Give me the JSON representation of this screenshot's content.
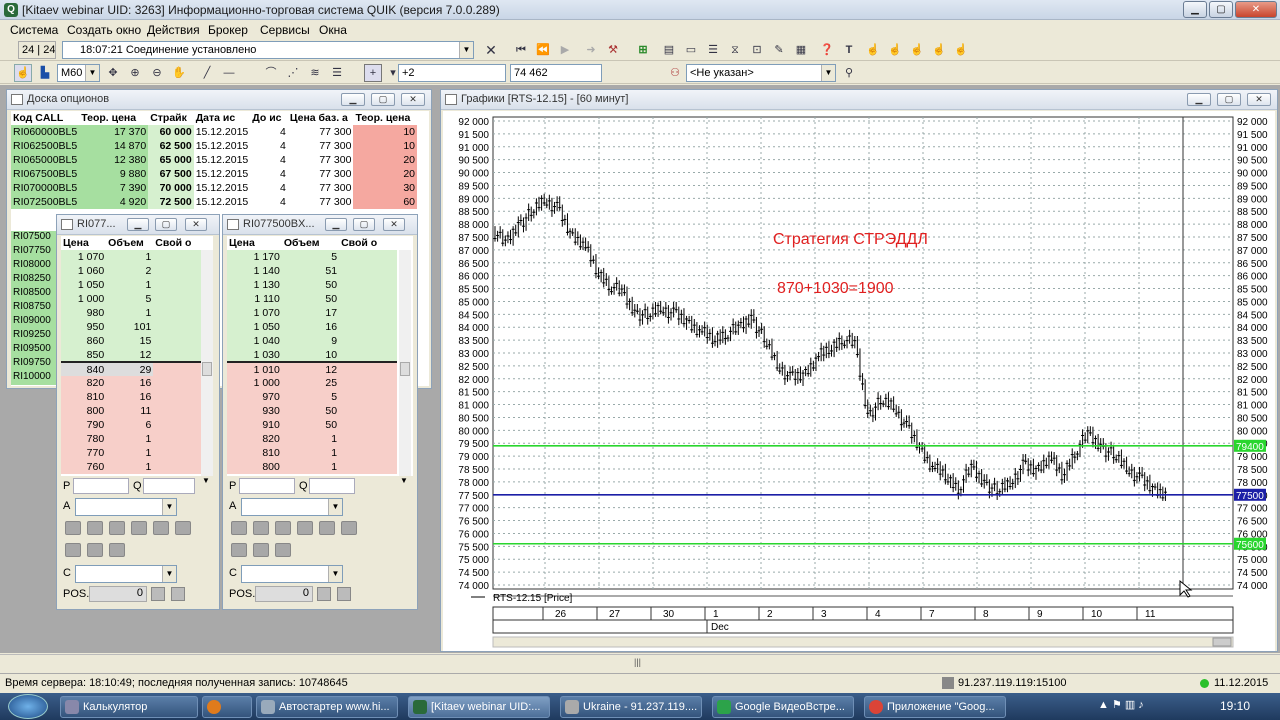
{
  "window": {
    "title": "[Kitaev webinar UID: 3263] Информационно-торговая система QUIK (версия 7.0.0.289)",
    "icon": "quik-logo-icon"
  },
  "menu": [
    "Система",
    "Создать окно",
    "Действия",
    "Брокер",
    "Сервисы",
    "Окна"
  ],
  "toolbar": {
    "clock": "24 | 24",
    "message": "18:07:21  Соединение установлено",
    "interval": "M60",
    "step": "+2",
    "value": "74 462",
    "account": "<Не указан>"
  },
  "options_board": {
    "title": "Доска опционов",
    "headers": [
      "Код CALL",
      "Теор. цена",
      "Страйк",
      "Дата ис",
      "До ис",
      "Цена баз. а",
      "Теор. цена"
    ],
    "rows": [
      [
        "RI060000BL5",
        "17 370",
        "60 000",
        "15.12.2015",
        "4",
        "77 300",
        "10"
      ],
      [
        "RI062500BL5",
        "14 870",
        "62 500",
        "15.12.2015",
        "4",
        "77 300",
        "10"
      ],
      [
        "RI065000BL5",
        "12 380",
        "65 000",
        "15.12.2015",
        "4",
        "77 300",
        "20"
      ],
      [
        "RI067500BL5",
        "9 880",
        "67 500",
        "15.12.2015",
        "4",
        "77 300",
        "20"
      ],
      [
        "RI070000BL5",
        "7 390",
        "70 000",
        "15.12.2015",
        "4",
        "77 300",
        "30"
      ],
      [
        "RI072500BL5",
        "4 920",
        "72 500",
        "15.12.2015",
        "4",
        "77 300",
        "60"
      ]
    ],
    "left_codes": [
      "RI07500",
      "RI07750",
      "RI08000",
      "RI08250",
      "RI08500",
      "RI08750",
      "RI09000",
      "RI09250",
      "RI09500",
      "RI09750",
      "RI10000"
    ]
  },
  "orderbook1": {
    "title": "RI077...",
    "headers": [
      "Цена",
      "Объем",
      "Свой о"
    ],
    "bids_sell": [
      [
        "1 070",
        "1"
      ],
      [
        "1 060",
        "2"
      ],
      [
        "1 050",
        "1"
      ],
      [
        "1 000",
        "5"
      ],
      [
        "980",
        "1"
      ],
      [
        "950",
        "101"
      ],
      [
        "860",
        "15"
      ],
      [
        "850",
        "12"
      ]
    ],
    "buys": [
      [
        "840",
        "29"
      ],
      [
        "820",
        "16"
      ],
      [
        "810",
        "16"
      ],
      [
        "800",
        "11"
      ],
      [
        "790",
        "6"
      ],
      [
        "780",
        "1"
      ],
      [
        "770",
        "1"
      ],
      [
        "760",
        "1"
      ]
    ],
    "labels": {
      "p": "P",
      "q": "Q",
      "a": "A",
      "c": "C",
      "pos": "POS.",
      "pos_val": "0"
    }
  },
  "orderbook2": {
    "title": "RI077500BX...",
    "headers": [
      "Цена",
      "Объем",
      "Свой о"
    ],
    "bids_sell": [
      [
        "1 170",
        "5"
      ],
      [
        "1 140",
        "51"
      ],
      [
        "1 130",
        "50"
      ],
      [
        "1 110",
        "50"
      ],
      [
        "1 070",
        "17"
      ],
      [
        "1 050",
        "16"
      ],
      [
        "1 040",
        "9"
      ],
      [
        "1 030",
        "10"
      ]
    ],
    "buys": [
      [
        "1 010",
        "12"
      ],
      [
        "1 000",
        "25"
      ],
      [
        "970",
        "5"
      ],
      [
        "930",
        "50"
      ],
      [
        "910",
        "50"
      ],
      [
        "820",
        "1"
      ],
      [
        "810",
        "1"
      ],
      [
        "800",
        "1"
      ]
    ],
    "labels": {
      "p": "P",
      "q": "Q",
      "a": "A",
      "c": "C",
      "pos": "POS.",
      "pos_val": "0"
    }
  },
  "chart_window": {
    "title": "Графики [RTS-12.15] - [60 минут]"
  },
  "chart_data": {
    "type": "candlestick",
    "title": "",
    "instrument": "RTS-12.15 [Price]",
    "ylim": [
      74000,
      92000
    ],
    "yticks": [
      "92 000",
      "91 500",
      "91 000",
      "90 500",
      "90 000",
      "89 500",
      "89 000",
      "88 500",
      "88 000",
      "87 500",
      "87 000",
      "86 500",
      "86 000",
      "85 500",
      "85 000",
      "84 500",
      "84 000",
      "83 500",
      "83 000",
      "82 500",
      "82 000",
      "81 500",
      "81 000",
      "80 500",
      "80 000",
      "79 500",
      "79 000",
      "78 500",
      "78 000",
      "77 500",
      "77 000",
      "76 500",
      "76 000",
      "75 500",
      "75 000",
      "74 500",
      "74 000"
    ],
    "x_dates": [
      "26",
      "27",
      "30",
      "1",
      "2",
      "3",
      "4",
      "7",
      "8",
      "9",
      "10",
      "11"
    ],
    "month_label": "Dec",
    "price_path": [
      87800,
      87200,
      88000,
      88400,
      89000,
      88600,
      87600,
      87300,
      86200,
      85700,
      85300,
      84600,
      84400,
      84800,
      84500,
      84200,
      83900,
      83500,
      83800,
      83900,
      84400,
      83500,
      82600,
      82000,
      82100,
      82800,
      83100,
      83600,
      83300,
      80600,
      81100,
      81000,
      80100,
      79300,
      78600,
      78200,
      77800,
      78500,
      78000,
      77600,
      78000,
      78600,
      78400,
      79000,
      78200,
      79200,
      79800,
      79400,
      79000,
      78600,
      78100,
      77700,
      77600
    ],
    "annotations": [
      "Стратегия СТРЭДДЛ",
      "870+1030=1900"
    ],
    "hlines": [
      {
        "value": 79400,
        "label": "79400",
        "color": "#29d62e"
      },
      {
        "value": 77500,
        "label": "77500",
        "color": "#1b1fa6"
      },
      {
        "value": 75600,
        "label": "75600",
        "color": "#29d62e"
      }
    ]
  },
  "status": {
    "left": "Время сервера: 18:10:49; последняя полученная запись: 10748645",
    "server": "91.237.119.119:15100",
    "date": "11.12.2015"
  },
  "taskbar": {
    "items": [
      "Калькулятор",
      "",
      "Автостартер www.hi...",
      "[Kitaev webinar UID:...",
      "Ukraine - 91.237.119....",
      "Google ВидеоВстре...",
      "Приложение \"Goog..."
    ],
    "time": "19:10"
  }
}
